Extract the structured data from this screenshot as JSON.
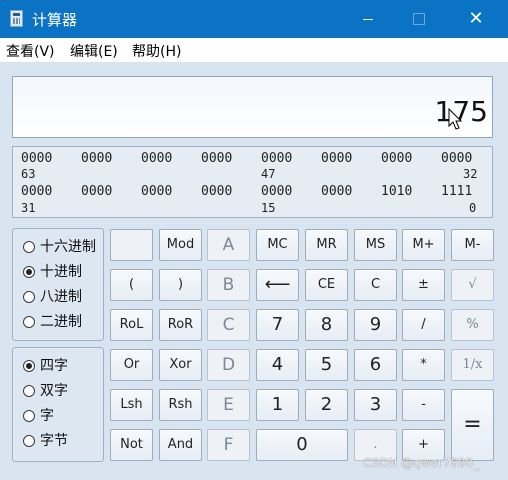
{
  "window": {
    "title": "计算器"
  },
  "menu": [
    "查看(V)",
    "编辑(E)",
    "帮助(H)"
  ],
  "display": {
    "value": "175"
  },
  "bits": {
    "row1": [
      "0000",
      "0000",
      "0000",
      "0000",
      "0000",
      "0000",
      "0000",
      "0000"
    ],
    "row1_pos": [
      "63",
      "47",
      "32"
    ],
    "row2": [
      "0000",
      "0000",
      "0000",
      "0000",
      "0000",
      "0000",
      "1010",
      "1111"
    ],
    "row2_pos": [
      "31",
      "15",
      "0"
    ]
  },
  "radix": [
    {
      "label": "十六进制",
      "selected": false
    },
    {
      "label": "十进制",
      "selected": true
    },
    {
      "label": "八进制",
      "selected": false
    },
    {
      "label": "二进制",
      "selected": false
    }
  ],
  "wordsize": [
    {
      "label": "四字",
      "selected": true
    },
    {
      "label": "双字",
      "selected": false
    },
    {
      "label": "字",
      "selected": false
    },
    {
      "label": "字节",
      "selected": false
    }
  ],
  "keys": {
    "mod": "Mod",
    "A": "A",
    "MC": "MC",
    "MR": "MR",
    "MS": "MS",
    "Mplus": "M+",
    "Mminus": "M-",
    "lparen": "(",
    "rparen": ")",
    "B": "B",
    "back": "⟵",
    "CE": "CE",
    "C": "C",
    "pm": "±",
    "sqrt": "√",
    "RoL": "RoL",
    "RoR": "RoR",
    "Ckey": "C",
    "n7": "7",
    "n8": "8",
    "n9": "9",
    "div": "/",
    "pct": "%",
    "Or": "Or",
    "Xor": "Xor",
    "D": "D",
    "n4": "4",
    "n5": "5",
    "n6": "6",
    "mul": "*",
    "recip": "1/x",
    "Lsh": "Lsh",
    "Rsh": "Rsh",
    "E": "E",
    "n1": "1",
    "n2": "2",
    "n3": "3",
    "sub": "-",
    "eq": "=",
    "Not": "Not",
    "And": "And",
    "F": "F",
    "n0": "0",
    "dot": ".",
    "add": "+"
  },
  "watermark": "CSDN @qwer7890_"
}
